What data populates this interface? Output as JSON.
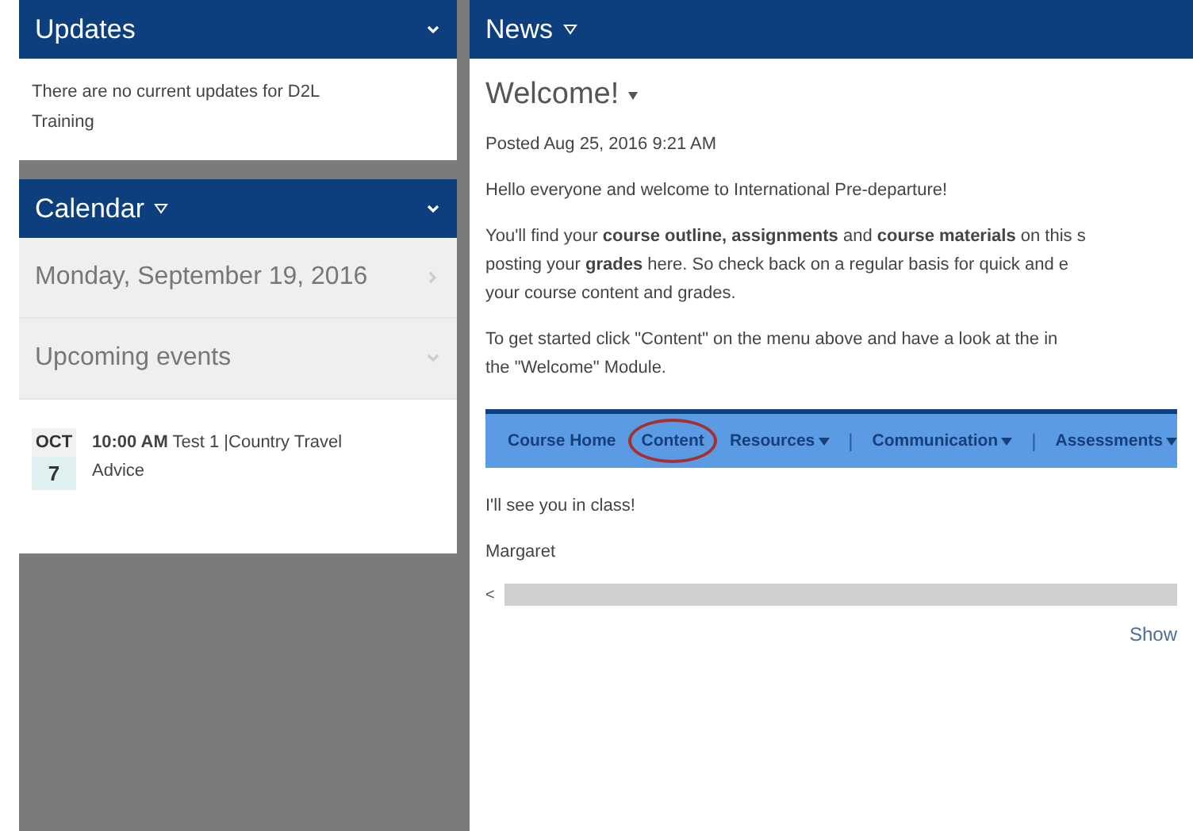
{
  "updates": {
    "title": "Updates",
    "message": "There are no current updates for D2L Training"
  },
  "calendar": {
    "title": "Calendar",
    "date": "Monday, September 19, 2016",
    "upcoming": "Upcoming events",
    "events": [
      {
        "month": "OCT",
        "day": "7",
        "time": "10:00 AM",
        "title": "Test 1 |Country Travel Advice"
      }
    ]
  },
  "news": {
    "title": "News",
    "item_title": "Welcome!",
    "posted": "Posted Aug 25, 2016 9:21 AM",
    "paragraphs": [
      [
        "Hello everyone and welcome to International Pre-departure!"
      ],
      [
        "You'll find your **course outline, assignments** and **course materials** on this s",
        "posting your **grades** here. So check back on a regular basis for quick and e",
        "your course content and grades."
      ],
      [
        "To get started click \"Content\" on the menu above and have a look at the in",
        "the \"Welcome\" Module."
      ]
    ],
    "nav": [
      {
        "kind": "link",
        "label": "Course Home",
        "has_menu": false,
        "circled": false
      },
      {
        "kind": "link",
        "label": "Content",
        "has_menu": false,
        "circled": true
      },
      {
        "kind": "link",
        "label": "Resources",
        "has_menu": true,
        "circled": false
      },
      {
        "kind": "divider",
        "label": "|"
      },
      {
        "kind": "link",
        "label": "Communication",
        "has_menu": true,
        "circled": false
      },
      {
        "kind": "divider",
        "label": "|"
      },
      {
        "kind": "link",
        "label": "Assessments",
        "has_menu": true,
        "circled": false
      }
    ],
    "closing": [
      [
        "I'll see you in class!"
      ],
      [
        "Margaret"
      ]
    ],
    "scroll_left": "<",
    "show_link": "Show"
  }
}
